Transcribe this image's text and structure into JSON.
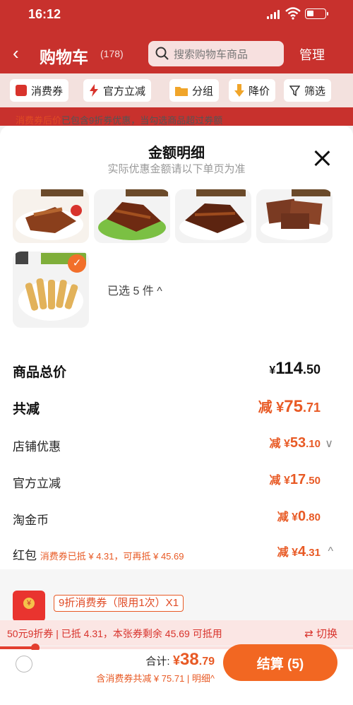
{
  "status_bar": {
    "time": "16:12"
  },
  "header": {
    "title": "购物车",
    "count": "(178)",
    "search_placeholder": "搜索购物车商品",
    "manage": "管理"
  },
  "filters": [
    {
      "label": "消费券",
      "icon": "coupon-icon",
      "color": "#d8332c"
    },
    {
      "label": "官方立减",
      "icon": "lightning-icon",
      "color": "#d8332c"
    },
    {
      "label": "分组",
      "icon": "folder-icon",
      "color": "#f0a52a"
    },
    {
      "label": "降价",
      "icon": "price-down-icon",
      "color": "#f0a52a"
    },
    {
      "label": "筛选",
      "icon": "funnel-icon",
      "color": "#333333"
    }
  ],
  "hint": {
    "emph": "消费券后价",
    "rest": "已包含9折券优惠，当勾选商品超过券额"
  },
  "sheet": {
    "title": "金额明细",
    "subtitle": "实际优惠金额请以下单页为准",
    "selected_label": "已选 5 件 ^",
    "rows": [
      {
        "label": "商品总价",
        "prefix": "¥",
        "int": "114",
        "dec": ".50",
        "bold": true,
        "dark": true
      },
      {
        "label": "共减",
        "prefix": "减 ¥",
        "int": "75",
        "dec": ".71",
        "bold": true,
        "dark": false
      },
      {
        "label": "店铺优惠",
        "prefix": "减 ¥",
        "int": "53",
        "dec": ".10",
        "chevron": "∨"
      },
      {
        "label": "官方立减",
        "prefix": "减 ¥",
        "int": "17",
        "dec": ".50"
      },
      {
        "label": "淘金币",
        "prefix": "减 ¥",
        "int": "0",
        "dec": ".80"
      },
      {
        "label": "红包",
        "note": "消费券已抵 ¥ 4.31，可再抵 ¥ 45.69",
        "prefix": "减 ¥",
        "int": "4",
        "dec": ".31",
        "chevron": "^"
      }
    ],
    "coupon_label": "9折消费券（限用1次）X1",
    "coupon_strip": "50元9折券 | 已抵 4.31，本张券剩余 45.69 可抵用",
    "switch_label": "⇄ 切换",
    "coupon_progress": 0.1
  },
  "footer": {
    "total_label": "合计:",
    "currency": "¥",
    "total_int": "38",
    "total_dec": ".79",
    "discount_note": "含消费券共减 ¥ 75.71 | 明细^",
    "checkout": "结算 (5)"
  },
  "colors": {
    "brand_red": "#c8312d",
    "accent_orange": "#f26722",
    "price_orange": "#e85a25"
  }
}
